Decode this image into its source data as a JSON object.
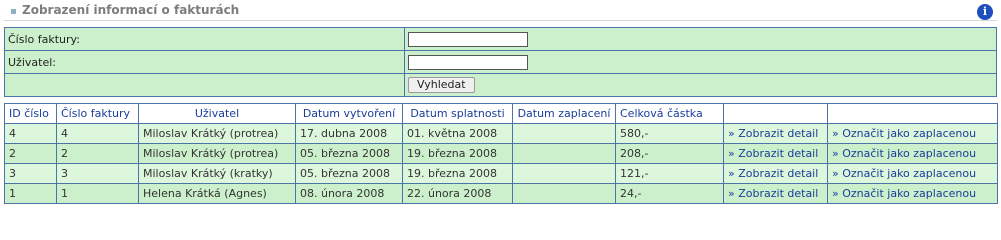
{
  "header": {
    "title": "Zobrazení informací o fakturách",
    "info_icon": "info-icon",
    "info_glyph": "i"
  },
  "search": {
    "invoice_label": "Číslo faktury:",
    "invoice_value": "",
    "user_label": "Uživatel:",
    "user_value": "",
    "search_button": "Vyhledat"
  },
  "table": {
    "columns": [
      "ID číslo",
      "Číslo faktury",
      "Uživatel",
      "Datum vytvoření",
      "Datum splatnosti",
      "Datum zaplacení",
      "Celková částka",
      "",
      ""
    ],
    "detail_link": "» Zobrazit detail",
    "pay_link": "» Označit jako zaplacenou",
    "rows": [
      {
        "id": "4",
        "invoice": "4",
        "user": "Miloslav Krátký (protrea)",
        "created": "17. dubna 2008",
        "due": "01. května 2008",
        "paid": "",
        "total": "580,-"
      },
      {
        "id": "2",
        "invoice": "2",
        "user": "Miloslav Krátký (protrea)",
        "created": "05. března 2008",
        "due": "19. března 2008",
        "paid": "",
        "total": "208,-"
      },
      {
        "id": "3",
        "invoice": "3",
        "user": "Miloslav Krátký (kratky)",
        "created": "05. března 2008",
        "due": "19. března 2008",
        "paid": "",
        "total": "121,-"
      },
      {
        "id": "1",
        "invoice": "1",
        "user": "Helena Krátká (Agnes)",
        "created": "08. února 2008",
        "due": "22. února 2008",
        "paid": "",
        "total": "24,-"
      }
    ]
  }
}
